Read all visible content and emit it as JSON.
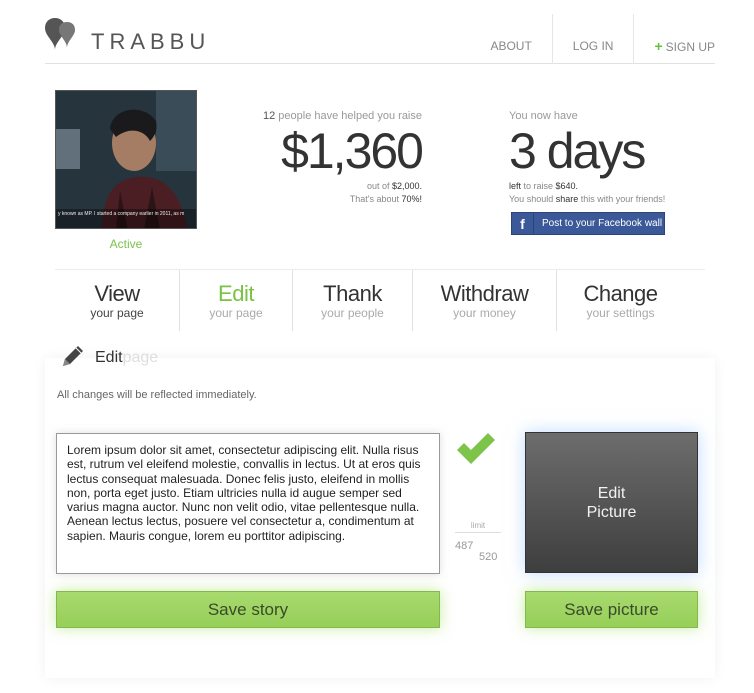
{
  "brand": {
    "name": "TRABBU"
  },
  "nav": {
    "about": "ABOUT",
    "login": "LOG IN",
    "signup": "SIGN UP",
    "plus": "+"
  },
  "profile": {
    "status": "Active",
    "photo_caption": "y known as MP. I started a company earlier in 2011, as m"
  },
  "raise": {
    "count": "12",
    "headline": " people have helped you raise",
    "amount": "$1,360",
    "out_of_prefix": "out of ",
    "goal": "$2,000.",
    "about_prefix": "That's about ",
    "percent": "70%!"
  },
  "days": {
    "headline": "You now have",
    "amount": "3 days",
    "left_prefix": "left",
    "left_text": " to raise ",
    "left_amount": "$640.",
    "share_prefix": "You should ",
    "share_word": "share",
    "share_suffix": " this with your friends!",
    "fb_icon": "f",
    "fb_label": "Post to your Facebook wall"
  },
  "tabs": [
    {
      "title": "View",
      "sub": "your page"
    },
    {
      "title": "Edit",
      "sub": "your page"
    },
    {
      "title": "Thank",
      "sub": "your people"
    },
    {
      "title": "Withdraw",
      "sub": "your money"
    },
    {
      "title": "Change",
      "sub": "your settings"
    }
  ],
  "edit": {
    "title": "Edit",
    "title_ghost": "page",
    "note": "All changes will be reflected immediately.",
    "story": "Lorem ipsum dolor sit amet, consectetur adipiscing elit. Nulla risus est, rutrum vel eleifend molestie, convallis in lectus. Ut at eros quis lectus consequat malesuada. Donec felis justo, eleifend in mollis non, porta eget justo. Etiam ultricies nulla id augue semper sed varius magna auctor. Nunc non velit odio, vitae pellentesque nulla. Aenean lectus lectus, posuere vel consectetur a, condimentum at sapien. Mauris congue, lorem eu porttitor adipiscing.",
    "limit_label": "limit",
    "limit_used": "487",
    "limit_max": "520",
    "picture_label": "Edit\nPicture",
    "save_story": "Save story",
    "save_picture": "Save picture"
  },
  "colors": {
    "accent_green": "#78c244",
    "button_green": "#9fd564",
    "facebook_blue": "#3b5998"
  }
}
